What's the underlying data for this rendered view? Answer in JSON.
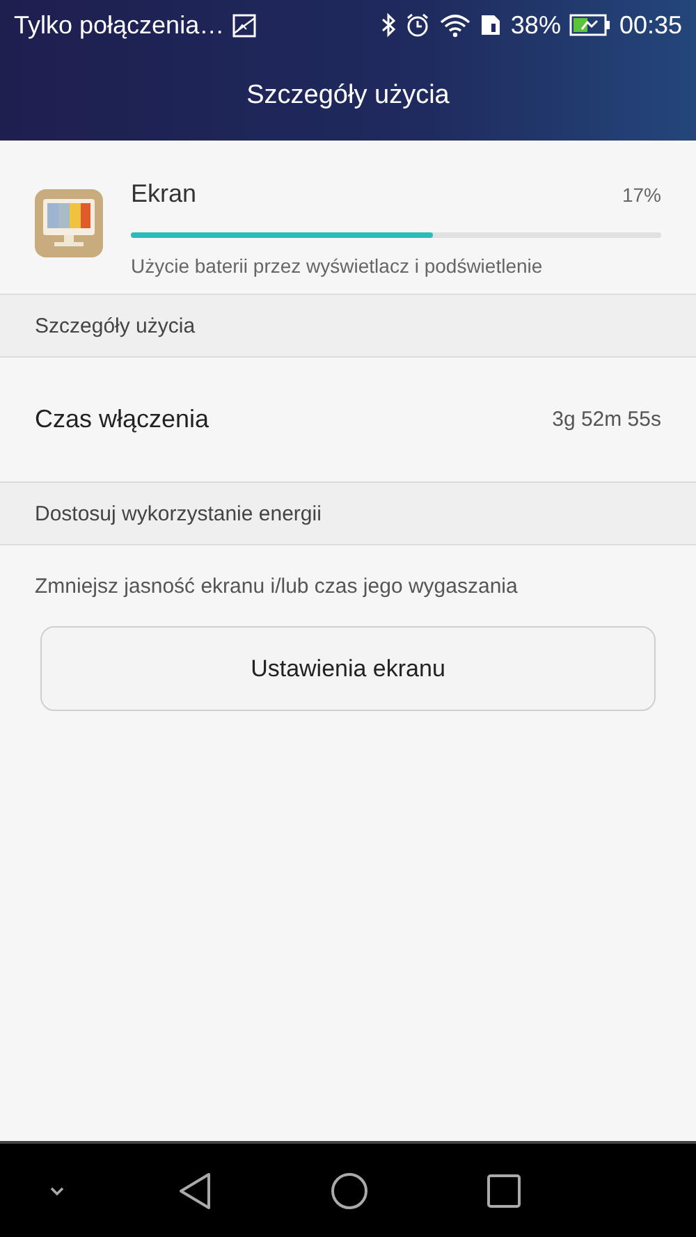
{
  "status_bar": {
    "carrier": "Tylko połączenia…",
    "battery": "38%",
    "time": "00:35"
  },
  "header": {
    "title": "Szczegóły użycia"
  },
  "app": {
    "name": "Ekran",
    "percent": "17%",
    "level": 0.57,
    "description": "Użycie baterii przez wyświetlacz i podświetlenie"
  },
  "sections": [
    {
      "title": "Szczegóły użycia",
      "rows": [
        {
          "kind": "value",
          "label": "Czas włączenia",
          "value": "3g 52m 55s"
        }
      ]
    },
    {
      "title": "Dostosuj wykorzystanie energii",
      "rows": [
        {
          "kind": "hint",
          "label": "Zmniejsz jasność ekranu i/lub czas jego wygaszania"
        },
        {
          "kind": "button",
          "label": "Ustawienia ekranu"
        }
      ]
    }
  ]
}
